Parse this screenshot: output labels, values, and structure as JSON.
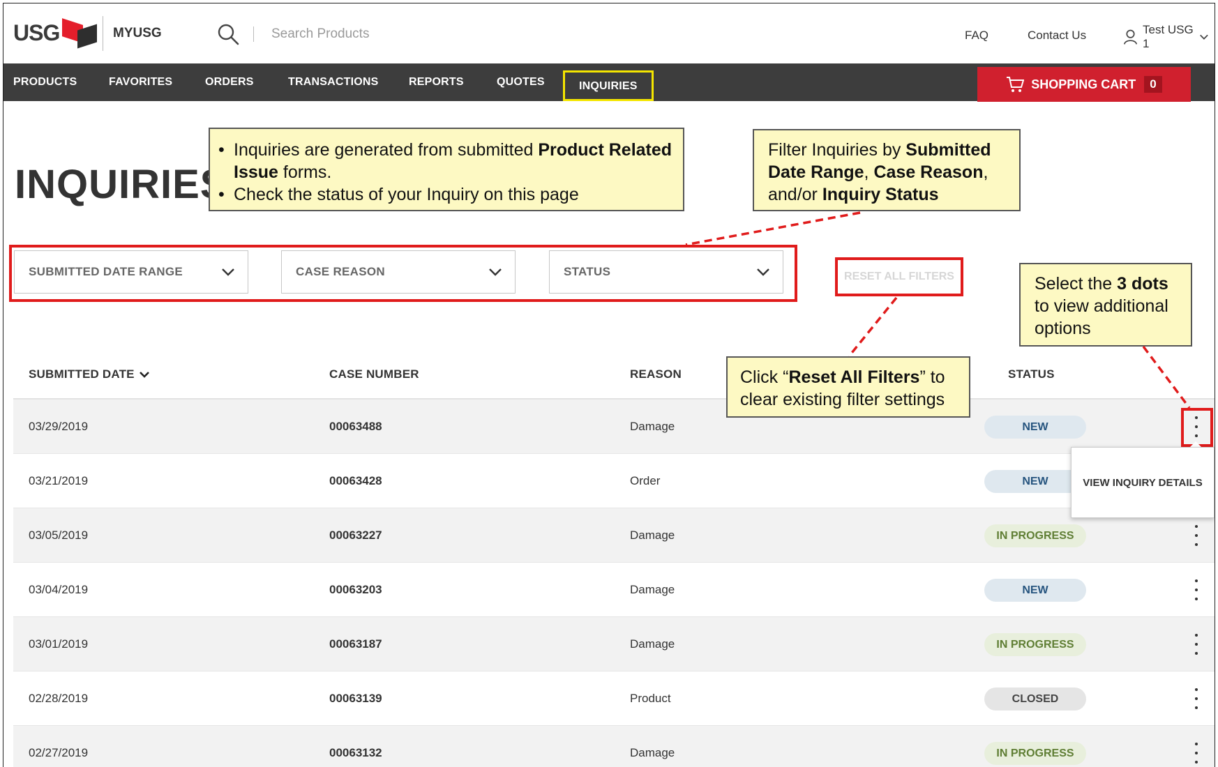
{
  "header": {
    "logo_text": "USG",
    "brand_label": "MYUSG",
    "search_placeholder": "Search Products",
    "faq": "FAQ",
    "contact": "Contact Us",
    "user_name": "Test USG 1"
  },
  "nav": {
    "items": [
      "PRODUCTS",
      "FAVORITES",
      "ORDERS",
      "TRANSACTIONS",
      "REPORTS",
      "QUOTES",
      "INQUIRIES"
    ],
    "active": "INQUIRIES",
    "cart_label": "SHOPPING CART",
    "cart_count": "0"
  },
  "page": {
    "title": "INQUIRIES"
  },
  "filters": {
    "date_range": "SUBMITTED DATE RANGE",
    "case_reason": "CASE REASON",
    "status": "STATUS",
    "reset": "RESET ALL FILTERS"
  },
  "table": {
    "headers": {
      "submitted_date": "SUBMITTED DATE",
      "case_number": "CASE NUMBER",
      "reason": "REASON",
      "status": "STATUS"
    },
    "rows": [
      {
        "date": "03/29/2019",
        "case": "00063488",
        "reason": "Damage",
        "status": "NEW"
      },
      {
        "date": "03/21/2019",
        "case": "00063428",
        "reason": "Order",
        "status": "NEW"
      },
      {
        "date": "03/05/2019",
        "case": "00063227",
        "reason": "Damage",
        "status": "IN PROGRESS"
      },
      {
        "date": "03/04/2019",
        "case": "00063203",
        "reason": "Damage",
        "status": "NEW"
      },
      {
        "date": "03/01/2019",
        "case": "00063187",
        "reason": "Damage",
        "status": "IN PROGRESS"
      },
      {
        "date": "02/28/2019",
        "case": "00063139",
        "reason": "Product",
        "status": "CLOSED"
      },
      {
        "date": "02/27/2019",
        "case": "00063132",
        "reason": "Damage",
        "status": "IN PROGRESS"
      }
    ],
    "row_menu_option": "VIEW INQUIRY DETAILS"
  },
  "annotations": {
    "intro": {
      "b1_pre": "Inquiries are generated from submitted ",
      "b1_bold": "Product Related Issue",
      "b1_post": " forms.",
      "b2": "Check the status of your Inquiry on this page"
    },
    "filter": {
      "pre": "Filter Inquiries by ",
      "bold1": "Submitted Date Range",
      "sep1": ", ",
      "bold2": "Case Reason",
      "sep2": ", and/or ",
      "bold3": "Inquiry Status"
    },
    "dots": {
      "pre": "Select the ",
      "bold": "3 dots",
      "post": " to view additional options"
    },
    "reset": {
      "pre": "Click “",
      "bold": "Reset All Filters",
      "post": "” to clear existing filter settings"
    }
  },
  "colors": {
    "nav_bg": "#3d3d3d",
    "cart_red": "#d0202e",
    "highlight_yellow": "#f5e600",
    "annotation_red": "#e01b1b",
    "callout_bg": "#fdf9c3"
  }
}
